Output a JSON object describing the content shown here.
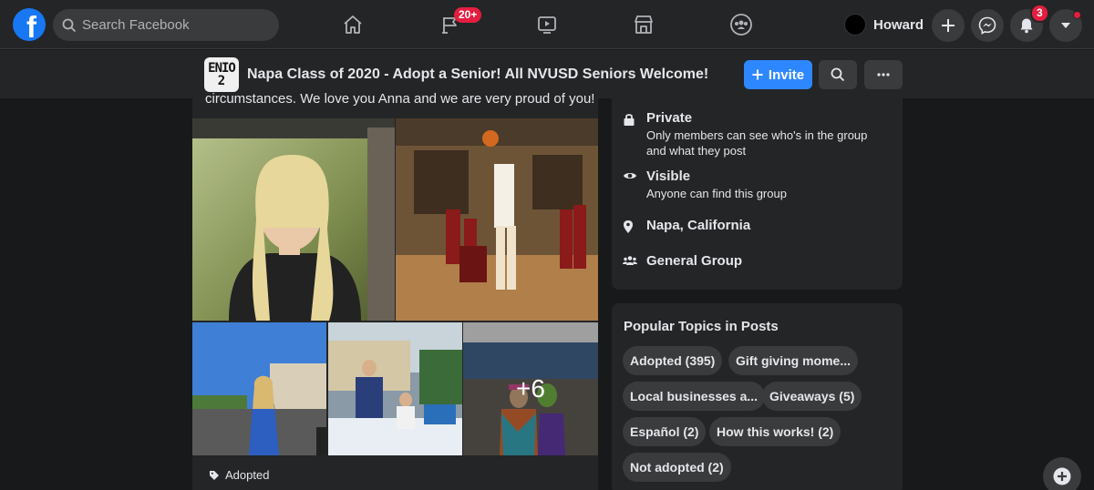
{
  "nav": {
    "logo": "f",
    "search_placeholder": "Search Facebook",
    "pages_badge": "20+",
    "profile_name": "Howard",
    "notifications_badge": "3"
  },
  "group": {
    "logo_line1": "ENIO",
    "logo_line2": "2",
    "title": "Napa Class of 2020 - Adopt a Senior! All NVUSD Seniors Welcome!",
    "invite_label": "Invite"
  },
  "post": {
    "text": "circumstances. We love you Anna and we are very proud of you!",
    "more_photos": "+6",
    "topic_tag": "Adopted"
  },
  "about": {
    "privacy_title": "Private",
    "privacy_desc_line1": "Only members can see who's in the group",
    "privacy_desc_line2": "and what they post",
    "visible_title": "Visible",
    "visible_desc": "Anyone can find this group",
    "location": "Napa, California",
    "group_type": "General Group"
  },
  "topics": {
    "title": "Popular Topics in Posts",
    "chips": [
      "Adopted (395)",
      "Gift giving mome...",
      "Local businesses a...",
      "Giveaways (5)",
      "Español (2)",
      "How this works! (2)",
      "Not adopted (2)"
    ]
  },
  "colors": {
    "background": "#18191a",
    "surface": "#242526",
    "accent": "#2d88ff",
    "badge": "#e41e3f"
  }
}
